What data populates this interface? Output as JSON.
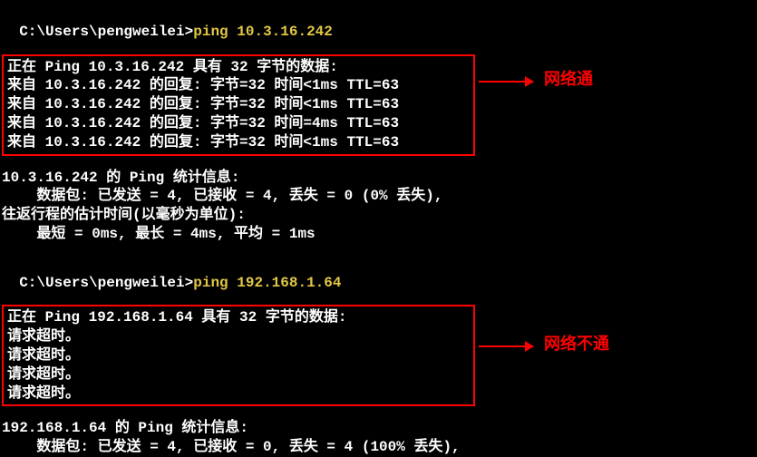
{
  "prompt1": {
    "path": "C:\\Users\\pengweilei",
    "sep": ">",
    "cmd": "ping 10.3.16.242"
  },
  "block1": {
    "header": "正在 Ping 10.3.16.242 具有 32 字节的数据:",
    "replies": [
      "来自 10.3.16.242 的回复: 字节=32 时间<1ms TTL=63",
      "来自 10.3.16.242 的回复: 字节=32 时间<1ms TTL=63",
      "来自 10.3.16.242 的回复: 字节=32 时间=4ms TTL=63",
      "来自 10.3.16.242 的回复: 字节=32 时间<1ms TTL=63"
    ]
  },
  "stats1": {
    "title": "10.3.16.242 的 Ping 统计信息:",
    "packets": "    数据包: 已发送 = 4, 已接收 = 4, 丢失 = 0 (0% 丢失),",
    "rtt_title": "往返行程的估计时间(以毫秒为单位):",
    "rtt": "    最短 = 0ms, 最长 = 4ms, 平均 = 1ms"
  },
  "prompt2": {
    "path": "C:\\Users\\pengweilei",
    "sep": ">",
    "cmd": "ping 192.168.1.64"
  },
  "block2": {
    "header": "正在 Ping 192.168.1.64 具有 32 字节的数据:",
    "replies": [
      "请求超时。",
      "请求超时。",
      "请求超时。",
      "请求超时。"
    ]
  },
  "stats2": {
    "title": "192.168.1.64 的 Ping 统计信息:",
    "packets": "    数据包: 已发送 = 4, 已接收 = 0, 丢失 = 4 (100% 丢失),"
  },
  "annotations": {
    "ok": "网络通",
    "fail": "网络不通"
  }
}
